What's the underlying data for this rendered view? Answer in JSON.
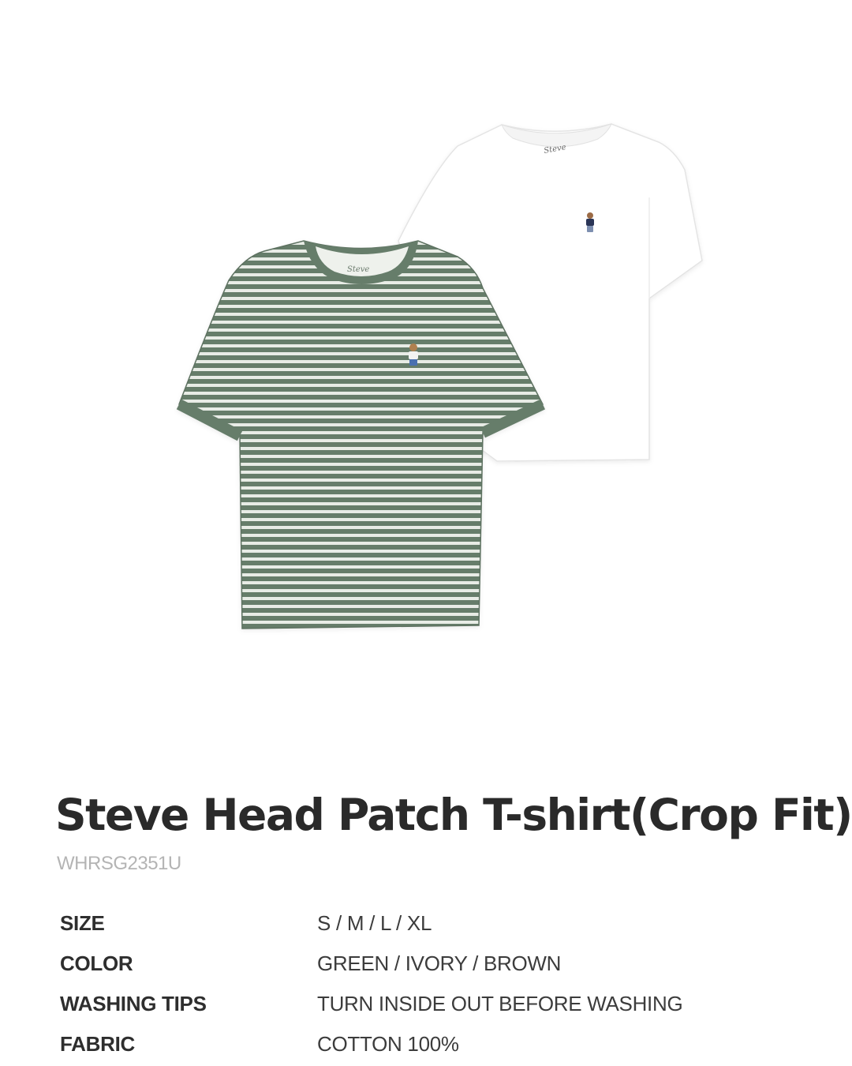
{
  "product": {
    "title": "Steve Head Patch T-shirt(Crop Fit)",
    "code": "WHRSG2351U",
    "images": [
      {
        "name": "green-striped-t-shirt",
        "color": "#667d6a"
      },
      {
        "name": "white-t-shirt",
        "color": "#ffffff"
      }
    ]
  },
  "specs": [
    {
      "label": "SIZE",
      "value": "S / M / L / XL"
    },
    {
      "label": "COLOR",
      "value": "GREEN / IVORY / BROWN"
    },
    {
      "label": "WASHING TIPS",
      "value": "TURN INSIDE OUT BEFORE WASHING"
    },
    {
      "label": "FABRIC",
      "value": "COTTON 100%"
    }
  ]
}
